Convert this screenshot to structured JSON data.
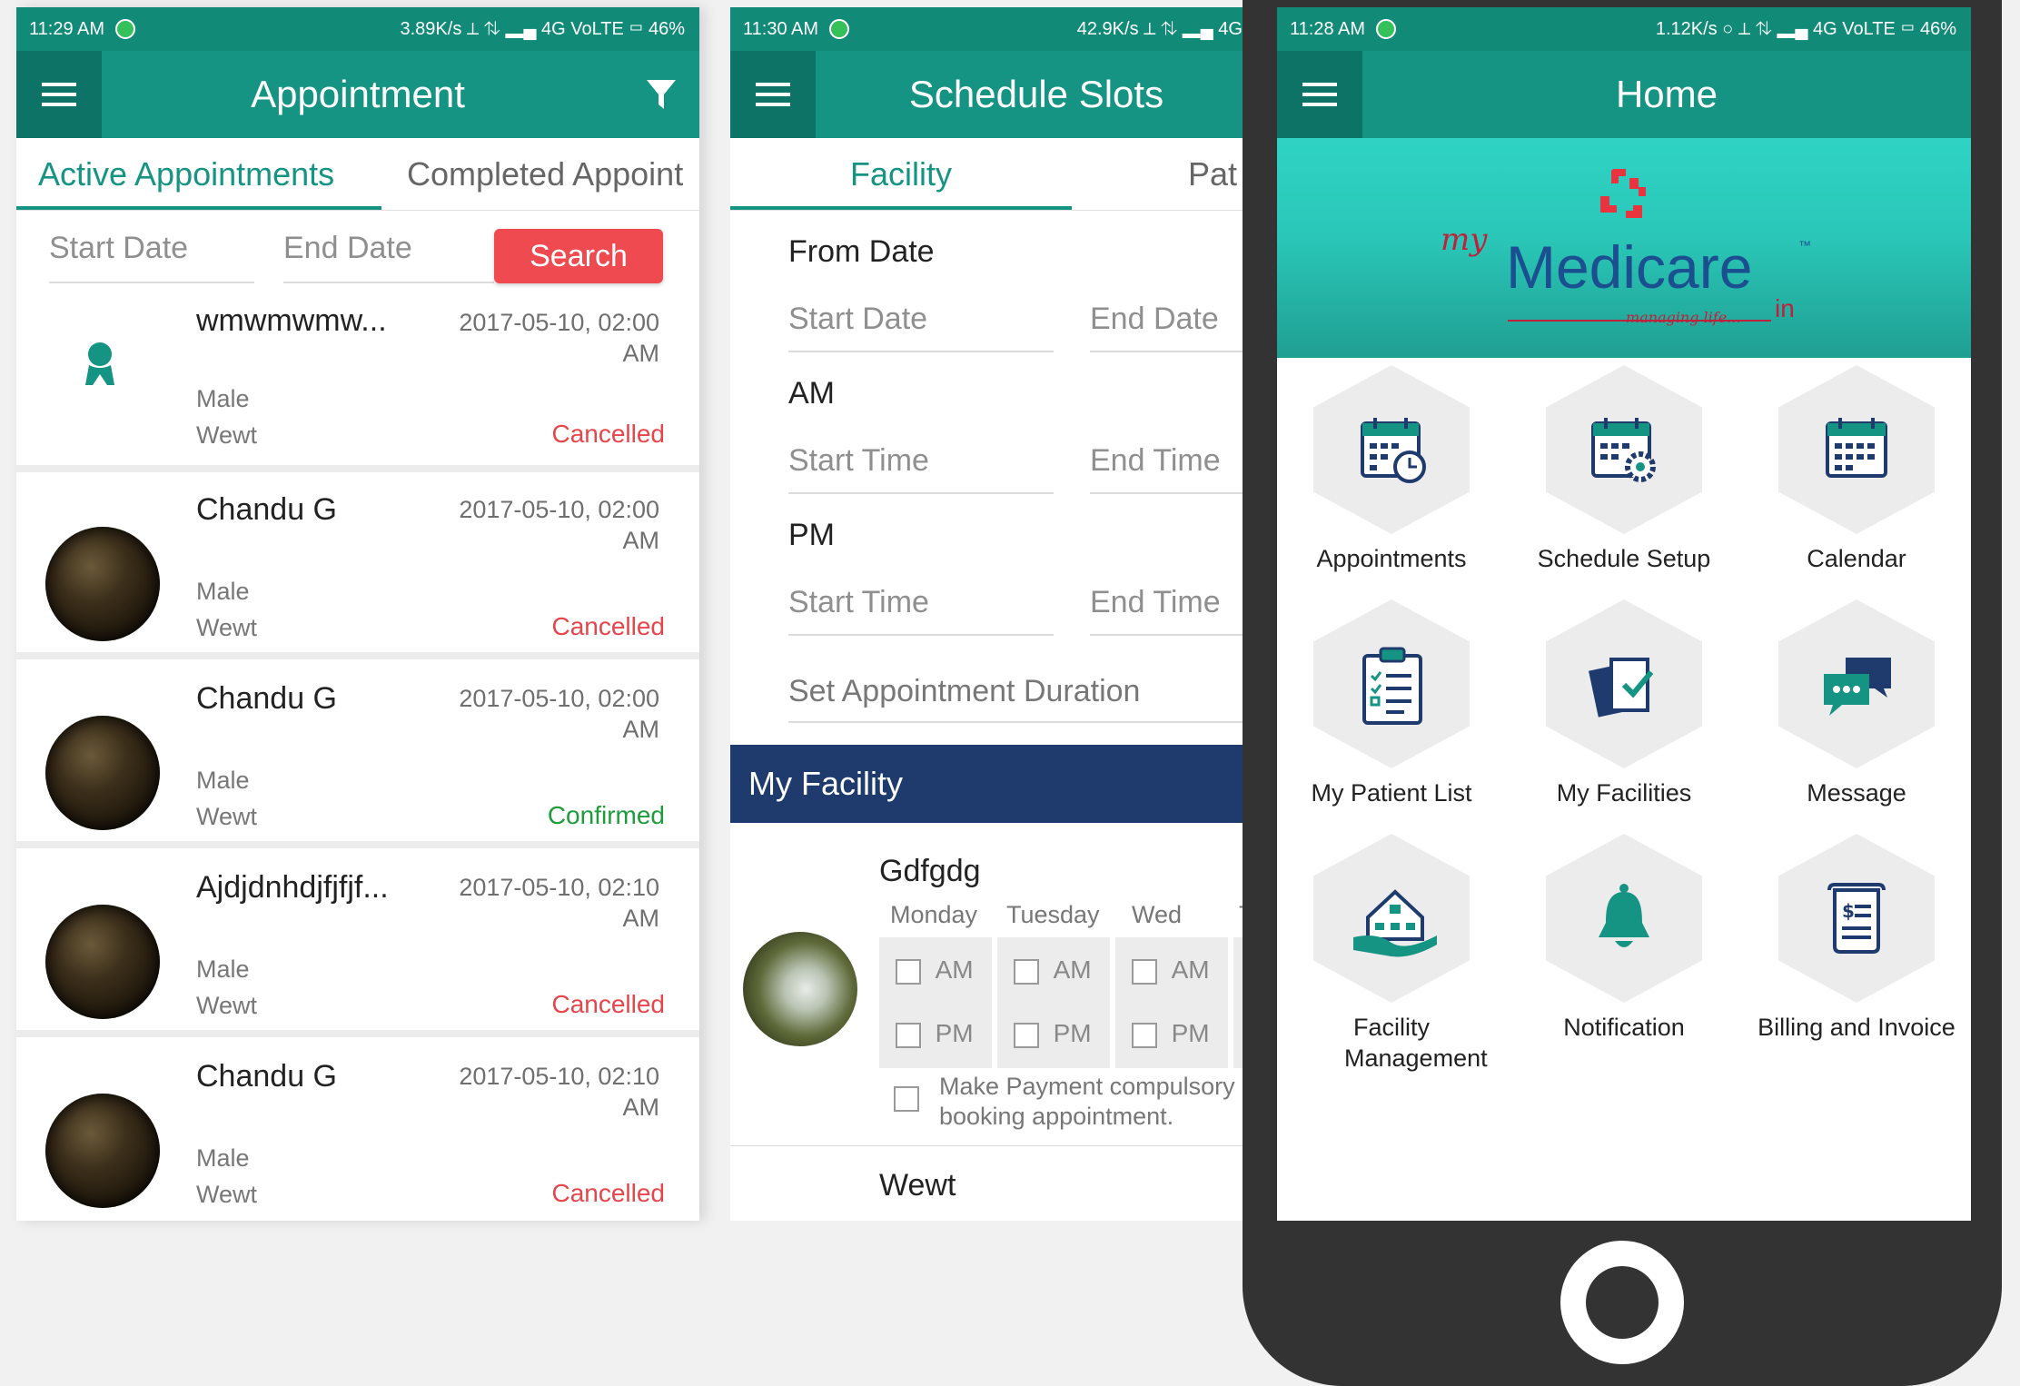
{
  "screen1": {
    "status_bar": {
      "time": "11:29 AM",
      "right": "3.89K/s ⟂ ⇅ ▂▄ 4G VoLTE ▭ 46%"
    },
    "title": "Appointment",
    "tabs": [
      {
        "label": "Active Appointments"
      },
      {
        "label": "Completed Appoint"
      }
    ],
    "filters": {
      "start_date": "Start Date",
      "end_date": "End Date",
      "search_label": "Search"
    },
    "appointments": [
      {
        "name": "wmwmwmw...",
        "date": "2017-05-10, 02:00",
        "ampm": "AM",
        "gender": "Male",
        "place": "Wewt",
        "status": "Cancelled"
      },
      {
        "name": "Chandu G",
        "date": "2017-05-10, 02:00",
        "ampm": "AM",
        "gender": "Male",
        "place": "Wewt",
        "status": "Cancelled"
      },
      {
        "name": "Chandu G",
        "date": "2017-05-10, 02:00",
        "ampm": "AM",
        "gender": "Male",
        "place": "Wewt",
        "status": "Confirmed"
      },
      {
        "name": "Ajdjdnhdjfjfjf...",
        "date": "2017-05-10, 02:10",
        "ampm": "AM",
        "gender": "Male",
        "place": "Wewt",
        "status": "Cancelled"
      },
      {
        "name": "Chandu G",
        "date": "2017-05-10, 02:10",
        "ampm": "AM",
        "gender": "Male",
        "place": "Wewt",
        "status": "Cancelled"
      }
    ]
  },
  "screen2": {
    "status_bar": {
      "time": "11:30 AM",
      "right": "42.9K/s ⟂ ⇅ ▂▄ 4G"
    },
    "title": "Schedule Slots",
    "tabs": [
      {
        "label": "Facility"
      },
      {
        "label": "Pat"
      }
    ],
    "from_date_label": "From Date",
    "start_date": "Start Date",
    "end_date": "End Date",
    "am_label": "AM",
    "pm_label": "PM",
    "start_time": "Start Time",
    "end_time": "End Time",
    "duration_placeholder": "Set Appointment Duration",
    "my_facility_label": "My Facility",
    "facilities": [
      {
        "name": "Gdfgdg",
        "days": [
          "Monday",
          "Tuesday",
          "Wed",
          "T"
        ],
        "am": "AM",
        "pm": "PM",
        "payment_note_1": "Make Payment compulsory",
        "payment_note_2": "booking appointment."
      },
      {
        "name": "Wewt"
      }
    ]
  },
  "screen3": {
    "status_bar": {
      "time": "11:28 AM",
      "right": "1.12K/s ○ ⟂ ⇅ ▂▄ 4G VoLTE ▭ 46%"
    },
    "title": "Home",
    "logo": {
      "prefix": "my",
      "name": "Medicare",
      "tm": "™",
      "tagline": "managing life...",
      "suffix": "in"
    },
    "grid": [
      {
        "label": "Appointments",
        "icon": "calendar-clock-icon"
      },
      {
        "label": "Schedule Setup",
        "icon": "calendar-gear-icon"
      },
      {
        "label": "Calendar",
        "icon": "calendar-icon"
      },
      {
        "label": "My Patient List",
        "icon": "clipboard-list-icon"
      },
      {
        "label": "My Facilities",
        "icon": "documents-check-icon"
      },
      {
        "label": "Message",
        "icon": "chat-bubbles-icon"
      },
      {
        "label": "Facility Management",
        "icon": "house-hand-icon"
      },
      {
        "label": "Notification",
        "icon": "bell-icon"
      },
      {
        "label": "Billing and Invoice",
        "icon": "invoice-icon"
      }
    ]
  },
  "colors": {
    "teal": "#169483",
    "teal_dark": "#0d7366",
    "cancelled": "#e8454b",
    "confirmed": "#1d9c3a",
    "search_red": "#ee4a4f",
    "facility_bar": "#1f3b6e",
    "phone_body": "#333333"
  }
}
